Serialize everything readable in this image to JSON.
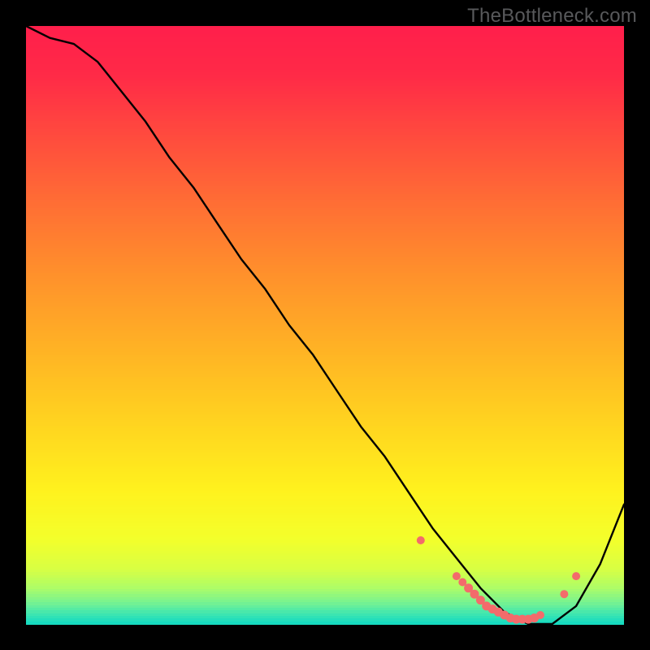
{
  "watermark": {
    "text": "TheBottleneck.com"
  },
  "chart_data": {
    "type": "line",
    "title": "",
    "xlabel": "",
    "ylabel": "",
    "xlim": [
      0,
      100
    ],
    "ylim": [
      0,
      100
    ],
    "grid": false,
    "legend": false,
    "series": [
      {
        "name": "bottleneck-curve",
        "x": [
          0,
          4,
          8,
          12,
          16,
          20,
          24,
          28,
          32,
          36,
          40,
          44,
          48,
          52,
          56,
          60,
          64,
          68,
          72,
          76,
          80,
          84,
          88,
          92,
          96,
          100
        ],
        "y": [
          100,
          98,
          97,
          94,
          89,
          84,
          78,
          73,
          67,
          61,
          56,
          50,
          45,
          39,
          33,
          28,
          22,
          16,
          11,
          6,
          2,
          0,
          0,
          3,
          10,
          20
        ]
      }
    ],
    "markers": {
      "name": "optimal-range-dots",
      "x": [
        66,
        72,
        73,
        74,
        75,
        76,
        77,
        78,
        79,
        80,
        81,
        82,
        83,
        84,
        85,
        86,
        90,
        92
      ],
      "y": [
        14,
        8,
        7,
        6,
        5,
        4,
        3,
        2.5,
        2,
        1.5,
        1,
        0.8,
        0.8,
        0.8,
        1,
        1.5,
        5,
        8
      ]
    },
    "gradient_stops": [
      {
        "pos": 0.0,
        "color": "#ff1f4b"
      },
      {
        "pos": 0.08,
        "color": "#ff2a47"
      },
      {
        "pos": 0.18,
        "color": "#ff4a3e"
      },
      {
        "pos": 0.3,
        "color": "#ff6f34"
      },
      {
        "pos": 0.42,
        "color": "#ff922b"
      },
      {
        "pos": 0.55,
        "color": "#ffb524"
      },
      {
        "pos": 0.68,
        "color": "#ffd81f"
      },
      {
        "pos": 0.78,
        "color": "#fff21e"
      },
      {
        "pos": 0.86,
        "color": "#f3ff2b"
      },
      {
        "pos": 0.91,
        "color": "#d8ff43"
      },
      {
        "pos": 0.94,
        "color": "#b0fd65"
      },
      {
        "pos": 0.965,
        "color": "#7af38f"
      },
      {
        "pos": 0.985,
        "color": "#3fe6b0"
      },
      {
        "pos": 1.0,
        "color": "#17dbc0"
      }
    ]
  }
}
